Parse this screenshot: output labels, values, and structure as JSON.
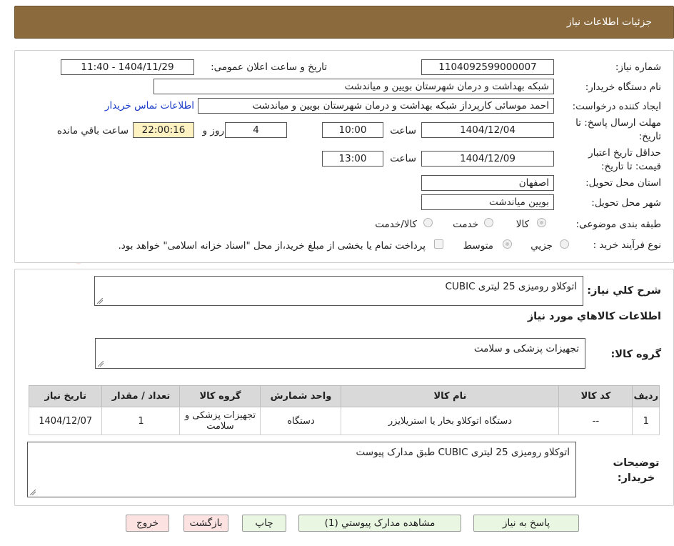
{
  "header": {
    "title": "جزئیات اطلاعات نیاز"
  },
  "form": {
    "need_number_label": "شماره نیاز:",
    "need_number": "1104092599000007",
    "announce_label": "تاریخ و ساعت اعلان عمومی:",
    "announce_value": "1404/11/29 - 11:40",
    "buyer_org_label": "نام دستگاه خریدار:",
    "buyer_org": "شبکه بهداشت و درمان شهرستان بویین و میاندشت",
    "creator_label": "ایجاد کننده درخواست:",
    "creator": "احمد موسائی کارپرداز شبکه بهداشت و درمان شهرستان بویین و میاندشت",
    "contact_link": "اطلاعات تماس خریدار",
    "reply_deadline_label": "مهلت ارسال پاسخ: تا تاریخ:",
    "reply_date": "1404/12/04",
    "time_label": "ساعت",
    "reply_time": "10:00",
    "days_value": "4",
    "days_label": "روز و",
    "remaining_time": "22:00:16",
    "remaining_label": "ساعت باقي مانده",
    "validity_label": "حداقل تاریخ اعتبار قیمت: تا تاریخ:",
    "validity_date": "1404/12/09",
    "validity_time": "13:00",
    "province_label": "استان محل تحویل:",
    "province": "اصفهان",
    "city_label": "شهر محل تحویل:",
    "city": "بویین میاندشت",
    "category_label": "طبقه بندی موضوعی:",
    "category_options": [
      "کالا",
      "خدمت",
      "کالا/خدمت"
    ],
    "process_label": "نوع فرآیند خرید :",
    "process_options": [
      "جزیي",
      "متوسط"
    ],
    "payment_note": "پرداخت تمام یا بخشی از مبلغ خرید،از محل \"اسناد خزانه اسلامی\" خواهد بود."
  },
  "summary": {
    "desc_label": "شرح کلي نیاز:",
    "desc_value": "اتوکلاو رومیزی 25 لیتری CUBIC",
    "goods_info_title": "اطلاعات کالاهاي مورد نیاز",
    "group_label": "گروه کالا:",
    "group_value": "تجهیزات پزشکی و سلامت",
    "table": {
      "headers": [
        "ردیف",
        "کد کالا",
        "نام کالا",
        "واحد شمارش",
        "گروه کالا",
        "تعداد / مقدار",
        "تاریخ نیاز"
      ],
      "rows": [
        [
          "1",
          "--",
          "دستگاه اتوکلاو بخار یا استریلایزر",
          "دستگاه",
          "تجهیزات پزشکی و سلامت",
          "1",
          "1404/12/07"
        ]
      ]
    },
    "buyer_notes_label": "توضیحات خریدار:",
    "buyer_notes": "اتوکلاو رومیزی 25 لیتری CUBIC  طبق مدارک پیوست"
  },
  "buttons": {
    "reply": "پاسخ به نیاز",
    "attachments": "مشاهده مدارک پیوستي (1)",
    "print": "چاپ",
    "back": "بازگشت",
    "exit": "خروج"
  },
  "watermark": {
    "text": "AriaTender.net"
  }
}
